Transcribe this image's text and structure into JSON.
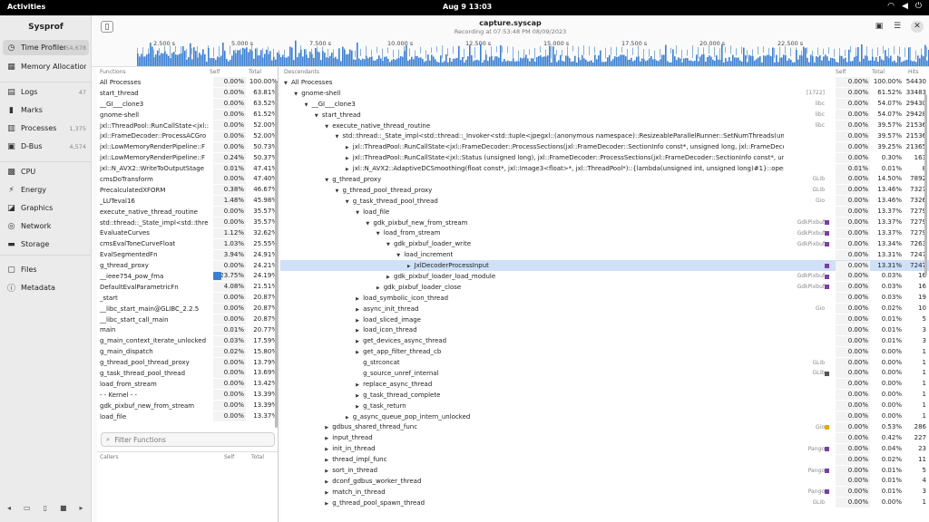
{
  "topbar": {
    "activities": "Activities",
    "clock": "Aug 9  13:03"
  },
  "app": {
    "title": "Sysprof"
  },
  "sidebar": {
    "items": [
      {
        "label": "Time Profiler",
        "count": "54,678",
        "icon": "clock-icon",
        "selected": true
      },
      {
        "label": "Memory Allocations",
        "count": "",
        "icon": "memory-icon"
      },
      {
        "label": "Logs",
        "count": "47",
        "icon": "logs-icon"
      },
      {
        "label": "Marks",
        "count": "",
        "icon": "marks-icon"
      },
      {
        "label": "Processes",
        "count": "1,375",
        "icon": "processes-icon"
      },
      {
        "label": "D-Bus",
        "count": "4,574",
        "icon": "dbus-icon"
      },
      {
        "label": "CPU",
        "count": "",
        "icon": "cpu-icon"
      },
      {
        "label": "Energy",
        "count": "",
        "icon": "energy-icon"
      },
      {
        "label": "Graphics",
        "count": "",
        "icon": "graphics-icon"
      },
      {
        "label": "Network",
        "count": "",
        "icon": "network-icon"
      },
      {
        "label": "Storage",
        "count": "",
        "icon": "storage-icon"
      },
      {
        "label": "Files",
        "count": "",
        "icon": "files-icon"
      },
      {
        "label": "Metadata",
        "count": "",
        "icon": "metadata-icon"
      }
    ]
  },
  "header": {
    "title": "capture.syscap",
    "subtitle": "Recording at 07:53:48 PM 08/09/2023"
  },
  "timeline": {
    "ticks": [
      "2.500 s",
      "5.000 s",
      "7.500 s",
      "10.000 s",
      "12.500 s",
      "15.000 s",
      "17.500 s",
      "20.000 s",
      "22.500 s"
    ],
    "color": "#3b7fd4"
  },
  "functions": {
    "headers": {
      "name": "Functions",
      "self": "Self",
      "total": "Total"
    },
    "rows": [
      {
        "name": "All Processes",
        "self": "0.00%",
        "total": "100.00%",
        "pct": 100
      },
      {
        "name": "start_thread",
        "self": "0.00%",
        "total": "63.81%",
        "pct": 63.81
      },
      {
        "name": "__GI___clone3",
        "self": "0.00%",
        "total": "63.52%",
        "pct": 63.52
      },
      {
        "name": "gnome-shell",
        "self": "0.00%",
        "total": "61.52%",
        "pct": 61.52
      },
      {
        "name": "jxl::ThreadPool::RunCallState<jxl::",
        "self": "0.00%",
        "total": "52.00%",
        "pct": 52
      },
      {
        "name": "jxl::FrameDecoder::ProcessACGro",
        "self": "0.00%",
        "total": "52.00%",
        "pct": 52
      },
      {
        "name": "jxl::LowMemoryRenderPipeline::F",
        "self": "0.00%",
        "total": "50.73%",
        "pct": 50.73
      },
      {
        "name": "jxl::LowMemoryRenderPipeline::F",
        "self": "0.24%",
        "total": "50.37%",
        "pct": 50.37
      },
      {
        "name": "jxl::N_AVX2::WriteToOutputStage",
        "self": "0.01%",
        "total": "47.41%",
        "pct": 47.41
      },
      {
        "name": "cmsDoTransform",
        "self": "0.00%",
        "total": "47.40%",
        "pct": 47.4
      },
      {
        "name": "PrecalculatedXFORM",
        "self": "0.38%",
        "total": "46.67%",
        "pct": 46.67
      },
      {
        "name": "_LUTeval16",
        "self": "1.48%",
        "total": "45.98%",
        "pct": 45.98
      },
      {
        "name": "execute_native_thread_routine",
        "self": "0.00%",
        "total": "35.57%",
        "pct": 35.57
      },
      {
        "name": "std::thread::_State_impl<std::thre",
        "self": "0.00%",
        "total": "35.57%",
        "pct": 35.57
      },
      {
        "name": "EvaluateCurves",
        "self": "1.12%",
        "total": "32.62%",
        "pct": 32.62
      },
      {
        "name": "cmsEvalToneCurveFloat",
        "self": "1.03%",
        "total": "25.55%",
        "pct": 25.55
      },
      {
        "name": "EvalSegmentedFn",
        "self": "3.94%",
        "total": "24.91%",
        "pct": 24.91
      },
      {
        "name": "g_thread_proxy",
        "self": "0.00%",
        "total": "24.21%",
        "pct": 24.21
      },
      {
        "name": "__ieee754_pow_fma",
        "self": "23.75%",
        "total": "24.19%",
        "pct": 24.19,
        "selfpct": 23.75
      },
      {
        "name": "DefaultEvalParametricFn",
        "self": "4.08%",
        "total": "21.51%",
        "pct": 21.51
      },
      {
        "name": "_start",
        "self": "0.00%",
        "total": "20.87%",
        "pct": 20.87
      },
      {
        "name": "__libc_start_main@GLIBC_2.2.5",
        "self": "0.00%",
        "total": "20.87%",
        "pct": 20.87
      },
      {
        "name": "__libc_start_call_main",
        "self": "0.00%",
        "total": "20.87%",
        "pct": 20.87
      },
      {
        "name": "main",
        "self": "0.01%",
        "total": "20.77%",
        "pct": 20.77
      },
      {
        "name": "g_main_context_iterate_unlocked",
        "self": "0.03%",
        "total": "17.59%",
        "pct": 17.59
      },
      {
        "name": "g_main_dispatch",
        "self": "0.02%",
        "total": "15.80%",
        "pct": 15.8
      },
      {
        "name": "g_thread_pool_thread_proxy",
        "self": "0.00%",
        "total": "13.79%",
        "pct": 13.79
      },
      {
        "name": "g_task_thread_pool_thread",
        "self": "0.00%",
        "total": "13.69%",
        "pct": 13.69
      },
      {
        "name": "load_from_stream",
        "self": "0.00%",
        "total": "13.42%",
        "pct": 13.42
      },
      {
        "name": "- - Kernel - -",
        "self": "0.00%",
        "total": "13.39%",
        "pct": 13.39
      },
      {
        "name": "gdk_pixbuf_new_from_stream",
        "self": "0.00%",
        "total": "13.39%",
        "pct": 13.39
      },
      {
        "name": "load_file",
        "self": "0.00%",
        "total": "13.37%",
        "pct": 13.37
      }
    ],
    "filter_placeholder": "Filter Functions",
    "callers_headers": {
      "name": "Callers",
      "self": "Self",
      "total": "Total"
    }
  },
  "descendants": {
    "headers": {
      "name": "Descendants",
      "self": "Self",
      "total": "Total",
      "hits": "Hits"
    },
    "rows": [
      {
        "depth": 0,
        "exp": "down",
        "name": "All Processes",
        "lib": "",
        "self": "0.00%",
        "total": "100.00%",
        "pct": 100,
        "hits": "54430"
      },
      {
        "depth": 1,
        "exp": "down",
        "name": "gnome-shell",
        "lib": "[1722]",
        "self": "0.00%",
        "total": "61.52%",
        "pct": 61.52,
        "hits": "33483"
      },
      {
        "depth": 2,
        "exp": "down",
        "name": "__GI___clone3",
        "lib": "libc",
        "self": "0.00%",
        "total": "54.07%",
        "pct": 54.07,
        "hits": "29430"
      },
      {
        "depth": 3,
        "exp": "down",
        "name": "start_thread",
        "lib": "libc",
        "self": "0.00%",
        "total": "54.07%",
        "pct": 54.07,
        "hits": "29428"
      },
      {
        "depth": 4,
        "exp": "down",
        "name": "execute_native_thread_routine",
        "lib": "libc",
        "self": "0.00%",
        "total": "39.57%",
        "pct": 39.57,
        "hits": "21536"
      },
      {
        "depth": 5,
        "exp": "down",
        "name": "std::thread::_State_impl<std::thread::_Invoker<std::tuple<jpegxl::(anonymous namespace)::ResizeableParallelRunner::SetNumThreads(unsigned long)::{lambda",
        "lib": "",
        "self": "0.00%",
        "total": "39.57%",
        "pct": 39.57,
        "hits": "21536"
      },
      {
        "depth": 6,
        "exp": "right",
        "name": "jxl::ThreadPool::RunCallState<jxl::FrameDecoder::ProcessSections(jxl::FrameDecoder::SectionInfo const*, unsigned long, jxl::FrameDecoder::SectionStatus",
        "lib": "",
        "self": "0.00%",
        "total": "39.25%",
        "pct": 39.25,
        "hits": "21365"
      },
      {
        "depth": 6,
        "exp": "right",
        "name": "jxl::ThreadPool::RunCallState<jxl::Status (unsigned long), jxl::FrameDecoder::ProcessSections(jxl::FrameDecoder::SectionInfo const*, unsigned long, jxl::Fra",
        "lib": "",
        "self": "0.00%",
        "total": "0.30%",
        "pct": 0.3,
        "hits": "163"
      },
      {
        "depth": 6,
        "exp": "right",
        "name": "jxl::N_AVX2::AdaptiveDCSmoothing(float const*, jxl::Image3<float>*, jxl::ThreadPool*)::{lambda(unsigned int, unsigned long)#1}::operator()(unsigned int, uns",
        "lib": "",
        "self": "0.01%",
        "total": "0.01%",
        "pct": 0.01,
        "hits": "8"
      },
      {
        "depth": 4,
        "exp": "down",
        "name": "g_thread_proxy",
        "lib": "GLib",
        "self": "0.00%",
        "total": "14.50%",
        "pct": 14.5,
        "hits": "7892"
      },
      {
        "depth": 5,
        "exp": "down",
        "name": "g_thread_pool_thread_proxy",
        "lib": "GLib",
        "self": "0.00%",
        "total": "13.46%",
        "pct": 13.46,
        "hits": "7327"
      },
      {
        "depth": 6,
        "exp": "down",
        "name": "g_task_thread_pool_thread",
        "lib": "Gio",
        "self": "0.00%",
        "total": "13.46%",
        "pct": 13.46,
        "hits": "7326"
      },
      {
        "depth": 7,
        "exp": "down",
        "name": "load_file",
        "lib": "",
        "self": "0.00%",
        "total": "13.37%",
        "pct": 13.37,
        "hits": "7279"
      },
      {
        "depth": 8,
        "exp": "down",
        "name": "gdk_pixbuf_new_from_stream",
        "lib": "GdkPixbuf",
        "dot": "#7b3fa8",
        "self": "0.00%",
        "total": "13.37%",
        "pct": 13.37,
        "hits": "7279"
      },
      {
        "depth": 9,
        "exp": "down",
        "name": "load_from_stream",
        "lib": "GdkPixbuf",
        "dot": "#7b3fa8",
        "self": "0.00%",
        "total": "13.37%",
        "pct": 13.37,
        "hits": "7279"
      },
      {
        "depth": 10,
        "exp": "down",
        "name": "gdk_pixbuf_loader_write",
        "lib": "GdkPixbuf",
        "dot": "#7b3fa8",
        "self": "0.00%",
        "total": "13.34%",
        "pct": 13.34,
        "hits": "7263"
      },
      {
        "depth": 11,
        "exp": "down",
        "name": "load_increment",
        "lib": "",
        "self": "0.00%",
        "total": "13.31%",
        "pct": 13.31,
        "hits": "7247"
      },
      {
        "depth": 12,
        "exp": "right",
        "name": "JxlDecoderProcessInput",
        "lib": "",
        "dot": "#7b3fa8",
        "self": "0.00%",
        "total": "13.31%",
        "pct": 13.31,
        "hits": "7247",
        "selected": true
      },
      {
        "depth": 10,
        "exp": "right",
        "name": "gdk_pixbuf_loader_load_module",
        "lib": "GdkPixbuf",
        "dot": "#7b3fa8",
        "self": "0.00%",
        "total": "0.03%",
        "pct": 0.03,
        "hits": "16"
      },
      {
        "depth": 9,
        "exp": "right",
        "name": "gdk_pixbuf_loader_close",
        "lib": "GdkPixbuf",
        "dot": "#7b3fa8",
        "self": "0.00%",
        "total": "0.03%",
        "pct": 0.03,
        "hits": "16"
      },
      {
        "depth": 7,
        "exp": "right",
        "name": "load_symbolic_icon_thread",
        "lib": "",
        "self": "0.00%",
        "total": "0.03%",
        "pct": 0.03,
        "hits": "19"
      },
      {
        "depth": 7,
        "exp": "right",
        "name": "async_init_thread",
        "lib": "Gio",
        "self": "0.00%",
        "total": "0.02%",
        "pct": 0.02,
        "hits": "10"
      },
      {
        "depth": 7,
        "exp": "right",
        "name": "load_sliced_image",
        "lib": "",
        "self": "0.00%",
        "total": "0.01%",
        "pct": 0.01,
        "hits": "5"
      },
      {
        "depth": 7,
        "exp": "right",
        "name": "load_icon_thread",
        "lib": "",
        "self": "0.00%",
        "total": "0.01%",
        "pct": 0.01,
        "hits": "3"
      },
      {
        "depth": 7,
        "exp": "right",
        "name": "get_devices_async_thread",
        "lib": "",
        "self": "0.00%",
        "total": "0.01%",
        "pct": 0.01,
        "hits": "3"
      },
      {
        "depth": 7,
        "exp": "right",
        "name": "get_app_filter_thread_cb",
        "lib": "",
        "self": "0.00%",
        "total": "0.00%",
        "pct": 0,
        "hits": "1"
      },
      {
        "depth": 7,
        "exp": "none",
        "name": "g_strconcat",
        "lib": "GLib",
        "self": "0.00%",
        "total": "0.00%",
        "pct": 0,
        "hits": "1"
      },
      {
        "depth": 7,
        "exp": "none",
        "name": "g_source_unref_internal",
        "lib": "GLib",
        "dot": "#555555",
        "self": "0.00%",
        "total": "0.00%",
        "pct": 0,
        "hits": "1"
      },
      {
        "depth": 7,
        "exp": "right",
        "name": "replace_async_thread",
        "lib": "",
        "self": "0.00%",
        "total": "0.00%",
        "pct": 0,
        "hits": "1"
      },
      {
        "depth": 7,
        "exp": "right",
        "name": "g_task_thread_complete",
        "lib": "",
        "self": "0.00%",
        "total": "0.00%",
        "pct": 0,
        "hits": "1"
      },
      {
        "depth": 7,
        "exp": "right",
        "name": "g_task_return",
        "lib": "",
        "self": "0.00%",
        "total": "0.00%",
        "pct": 0,
        "hits": "1"
      },
      {
        "depth": 6,
        "exp": "right",
        "name": "g_async_queue_pop_intern_unlocked",
        "lib": "",
        "self": "0.00%",
        "total": "0.00%",
        "pct": 0,
        "hits": "1"
      },
      {
        "depth": 4,
        "exp": "right",
        "name": "gdbus_shared_thread_func",
        "lib": "Gio",
        "dot": "#e8a800",
        "self": "0.00%",
        "total": "0.53%",
        "pct": 0.53,
        "hits": "286"
      },
      {
        "depth": 4,
        "exp": "right",
        "name": "input_thread",
        "lib": "",
        "self": "0.00%",
        "total": "0.42%",
        "pct": 0.42,
        "hits": "227"
      },
      {
        "depth": 4,
        "exp": "right",
        "name": "init_in_thread",
        "lib": "Pango",
        "dot": "#7b3fa8",
        "self": "0.00%",
        "total": "0.04%",
        "pct": 0.04,
        "hits": "23"
      },
      {
        "depth": 4,
        "exp": "right",
        "name": "thread_impl_func",
        "lib": "",
        "self": "0.00%",
        "total": "0.02%",
        "pct": 0.02,
        "hits": "11"
      },
      {
        "depth": 4,
        "exp": "right",
        "name": "sort_in_thread",
        "lib": "Pango",
        "dot": "#7b3fa8",
        "self": "0.00%",
        "total": "0.01%",
        "pct": 0.01,
        "hits": "5"
      },
      {
        "depth": 4,
        "exp": "right",
        "name": "dconf_gdbus_worker_thread",
        "lib": "",
        "self": "0.00%",
        "total": "0.01%",
        "pct": 0.01,
        "hits": "4"
      },
      {
        "depth": 4,
        "exp": "right",
        "name": "match_in_thread",
        "lib": "Pango",
        "dot": "#7b3fa8",
        "self": "0.00%",
        "total": "0.01%",
        "pct": 0.01,
        "hits": "3"
      },
      {
        "depth": 4,
        "exp": "right",
        "name": "g_thread_pool_spawn_thread",
        "lib": "GLib",
        "self": "0.00%",
        "total": "0.00%",
        "pct": 0,
        "hits": "1"
      }
    ]
  }
}
